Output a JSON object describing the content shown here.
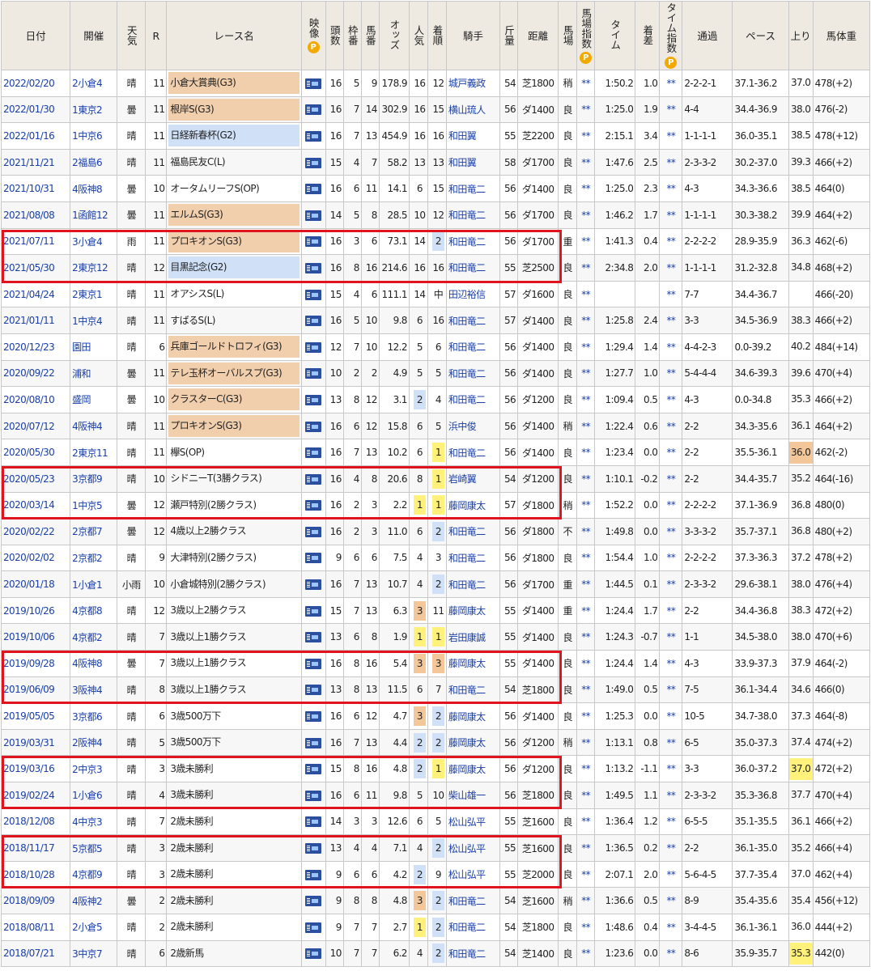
{
  "headers": {
    "date": "日付",
    "venue": "開催",
    "weather": "天気",
    "round": "R",
    "race": "レース名",
    "video": "映像",
    "heads": "頭数",
    "frame": "枠番",
    "horse": "馬番",
    "odds": "オッズ",
    "pop": "人気",
    "rank": "着順",
    "jockey": "騎手",
    "weight": "斤量",
    "dist": "距離",
    "track": "馬場",
    "track_index": "馬場指数",
    "time": "タイム",
    "margin": "着差",
    "time_index": "タイム指数",
    "passing": "通過",
    "pace": "ペース",
    "last3f": "上り",
    "body_weight": "馬体重",
    "p_icon_text": "P"
  },
  "rows": [
    {
      "date": "2022/02/20",
      "venue": "2小倉4",
      "weather": "晴",
      "round": "11",
      "race": "小倉大賞典(G3)",
      "grade": "g3",
      "heads": "16",
      "frame": "5",
      "horse": "9",
      "odds": "178.9",
      "pop": "16",
      "rank": "12",
      "jockey": "城戸義政",
      "weight": "54",
      "dist": "芝1800",
      "track": "稍",
      "ti": "**",
      "time": "1:50.2",
      "margin": "1.0",
      "tix": "**",
      "passing": "2-2-2-1",
      "pace": "37.1-36.2",
      "last3f": "37.0",
      "bw": "478(+2)"
    },
    {
      "date": "2022/01/30",
      "venue": "1東京2",
      "weather": "曇",
      "round": "11",
      "race": "根岸S(G3)",
      "grade": "g3",
      "heads": "16",
      "frame": "7",
      "horse": "14",
      "odds": "302.9",
      "pop": "16",
      "rank": "15",
      "jockey": "横山琉人",
      "weight": "56",
      "dist": "ダ1400",
      "track": "良",
      "ti": "**",
      "time": "1:25.0",
      "margin": "1.9",
      "tix": "**",
      "passing": "4-4",
      "pace": "34.4-36.9",
      "last3f": "38.0",
      "bw": "476(-2)"
    },
    {
      "date": "2022/01/16",
      "venue": "1中京6",
      "weather": "晴",
      "round": "11",
      "race": "日経新春杯(G2)",
      "grade": "g2",
      "heads": "16",
      "frame": "7",
      "horse": "13",
      "odds": "454.9",
      "pop": "16",
      "rank": "16",
      "jockey": "和田翼",
      "weight": "55",
      "dist": "芝2200",
      "track": "良",
      "ti": "**",
      "time": "2:15.1",
      "margin": "3.4",
      "tix": "**",
      "passing": "1-1-1-1",
      "pace": "36.0-35.1",
      "last3f": "38.5",
      "bw": "478(+12)"
    },
    {
      "date": "2021/11/21",
      "venue": "2福島6",
      "weather": "晴",
      "round": "11",
      "race": "福島民友C(L)",
      "grade": "",
      "heads": "15",
      "frame": "4",
      "horse": "7",
      "odds": "58.2",
      "pop": "13",
      "rank": "13",
      "jockey": "和田翼",
      "weight": "58",
      "dist": "ダ1700",
      "track": "良",
      "ti": "**",
      "time": "1:47.6",
      "margin": "2.5",
      "tix": "**",
      "passing": "2-3-3-2",
      "pace": "30.2-37.0",
      "last3f": "39.3",
      "bw": "466(+2)"
    },
    {
      "date": "2021/10/31",
      "venue": "4阪神8",
      "weather": "曇",
      "round": "10",
      "race": "オータムリーフS(OP)",
      "grade": "",
      "heads": "16",
      "frame": "6",
      "horse": "11",
      "odds": "14.1",
      "pop": "6",
      "rank": "15",
      "jockey": "和田竜二",
      "weight": "56",
      "dist": "ダ1400",
      "track": "良",
      "ti": "**",
      "time": "1:25.0",
      "margin": "2.3",
      "tix": "**",
      "passing": "4-3",
      "pace": "34.3-36.6",
      "last3f": "38.5",
      "bw": "464(0)"
    },
    {
      "date": "2021/08/08",
      "venue": "1函館12",
      "weather": "曇",
      "round": "11",
      "race": "エルムS(G3)",
      "grade": "g3",
      "heads": "14",
      "frame": "5",
      "horse": "8",
      "odds": "28.5",
      "pop": "10",
      "rank": "12",
      "jockey": "和田竜二",
      "weight": "56",
      "dist": "ダ1700",
      "track": "良",
      "ti": "**",
      "time": "1:46.2",
      "margin": "1.7",
      "tix": "**",
      "passing": "1-1-1-1",
      "pace": "30.3-38.2",
      "last3f": "39.9",
      "bw": "464(+2)"
    },
    {
      "date": "2021/07/11",
      "venue": "3小倉4",
      "weather": "雨",
      "round": "11",
      "race": "プロキオンS(G3)",
      "grade": "g3",
      "heads": "16",
      "frame": "3",
      "horse": "6",
      "odds": "73.1",
      "pop": "14",
      "rank": "2",
      "rankhl": "b",
      "jockey": "和田竜二",
      "weight": "56",
      "dist": "ダ1700",
      "track": "重",
      "ti": "**",
      "time": "1:41.3",
      "margin": "0.4",
      "tix": "**",
      "passing": "2-2-2-2",
      "pace": "28.9-35.9",
      "last3f": "36.3",
      "bw": "462(-6)"
    },
    {
      "date": "2021/05/30",
      "venue": "2東京12",
      "weather": "晴",
      "round": "12",
      "race": "目黒記念(G2)",
      "grade": "g2",
      "heads": "16",
      "frame": "8",
      "horse": "16",
      "odds": "214.6",
      "pop": "16",
      "rank": "16",
      "jockey": "和田竜二",
      "weight": "55",
      "dist": "芝2500",
      "track": "良",
      "ti": "**",
      "time": "2:34.8",
      "margin": "2.0",
      "tix": "**",
      "passing": "1-1-1-1",
      "pace": "31.2-32.8",
      "last3f": "34.8",
      "bw": "468(+2)"
    },
    {
      "date": "2021/04/24",
      "venue": "2東京1",
      "weather": "晴",
      "round": "11",
      "race": "オアシスS(L)",
      "grade": "",
      "heads": "15",
      "frame": "4",
      "horse": "6",
      "odds": "111.1",
      "pop": "14",
      "rank": "中",
      "jockey": "田辺裕信",
      "weight": "57",
      "dist": "ダ1600",
      "track": "良",
      "ti": "**",
      "time": "",
      "margin": "",
      "tix": "**",
      "passing": "7-7",
      "pace": "34.4-36.7",
      "last3f": "",
      "bw": "466(-20)"
    },
    {
      "date": "2021/01/11",
      "venue": "1中京4",
      "weather": "晴",
      "round": "11",
      "race": "すばるS(L)",
      "grade": "",
      "heads": "16",
      "frame": "5",
      "horse": "10",
      "odds": "9.8",
      "pop": "6",
      "rank": "16",
      "jockey": "和田竜二",
      "weight": "57",
      "dist": "ダ1400",
      "track": "良",
      "ti": "**",
      "time": "1:25.8",
      "margin": "2.4",
      "tix": "**",
      "passing": "3-3",
      "pace": "34.5-36.9",
      "last3f": "38.3",
      "bw": "466(+2)"
    },
    {
      "date": "2020/12/23",
      "venue": "園田",
      "weather": "晴",
      "round": "6",
      "race": "兵庫ゴールドトロフィ(G3)",
      "grade": "g3",
      "heads": "12",
      "frame": "7",
      "horse": "10",
      "odds": "12.2",
      "pop": "5",
      "rank": "6",
      "jockey": "和田竜二",
      "weight": "56",
      "dist": "ダ1400",
      "track": "良",
      "ti": "**",
      "time": "1:29.4",
      "margin": "1.4",
      "tix": "**",
      "passing": "4-4-2-3",
      "pace": "0.0-39.2",
      "last3f": "40.2",
      "bw": "484(+14)"
    },
    {
      "date": "2020/09/22",
      "venue": "浦和",
      "weather": "曇",
      "round": "11",
      "race": "テレ玉杯オーバルスプ(G3)",
      "grade": "g3",
      "heads": "10",
      "frame": "2",
      "horse": "2",
      "odds": "4.9",
      "pop": "5",
      "rank": "5",
      "jockey": "和田竜二",
      "weight": "56",
      "dist": "ダ1400",
      "track": "良",
      "ti": "**",
      "time": "1:27.7",
      "margin": "1.0",
      "tix": "**",
      "passing": "5-4-4-4",
      "pace": "34.6-39.3",
      "last3f": "39.6",
      "bw": "470(+4)"
    },
    {
      "date": "2020/08/10",
      "venue": "盛岡",
      "weather": "曇",
      "round": "10",
      "race": "クラスターC(G3)",
      "grade": "g3",
      "heads": "13",
      "frame": "8",
      "horse": "12",
      "odds": "3.1",
      "pop": "2",
      "pophl": "b",
      "rank": "4",
      "jockey": "和田竜二",
      "weight": "56",
      "dist": "ダ1200",
      "track": "良",
      "ti": "**",
      "time": "1:09.4",
      "margin": "0.5",
      "tix": "**",
      "passing": "4-3",
      "pace": "0.0-34.8",
      "last3f": "35.3",
      "bw": "466(+2)"
    },
    {
      "date": "2020/07/12",
      "venue": "4阪神4",
      "weather": "晴",
      "round": "11",
      "race": "プロキオンS(G3)",
      "grade": "g3",
      "heads": "16",
      "frame": "6",
      "horse": "12",
      "odds": "15.8",
      "pop": "6",
      "rank": "5",
      "jockey": "浜中俊",
      "weight": "56",
      "dist": "ダ1400",
      "track": "稍",
      "ti": "**",
      "time": "1:22.4",
      "margin": "0.6",
      "tix": "**",
      "passing": "2-2",
      "pace": "34.3-35.6",
      "last3f": "36.1",
      "bw": "464(+2)"
    },
    {
      "date": "2020/05/30",
      "venue": "2東京11",
      "weather": "晴",
      "round": "11",
      "race": "欅S(OP)",
      "grade": "",
      "heads": "16",
      "frame": "7",
      "horse": "13",
      "odds": "10.2",
      "pop": "6",
      "rank": "1",
      "rankhl": "y",
      "jockey": "和田竜二",
      "weight": "56",
      "dist": "ダ1400",
      "track": "良",
      "ti": "**",
      "time": "1:23.4",
      "margin": "0.0",
      "tix": "**",
      "passing": "2-2",
      "pace": "35.5-36.1",
      "last3f": "36.0",
      "uphl": "o",
      "bw": "462(-2)"
    },
    {
      "date": "2020/05/23",
      "venue": "3京都9",
      "weather": "晴",
      "round": "10",
      "race": "シドニーT(3勝クラス)",
      "grade": "",
      "heads": "16",
      "frame": "4",
      "horse": "8",
      "odds": "20.6",
      "pop": "8",
      "rank": "1",
      "rankhl": "y",
      "jockey": "岩崎翼",
      "weight": "54",
      "dist": "ダ1200",
      "track": "良",
      "ti": "**",
      "time": "1:10.1",
      "margin": "-0.2",
      "tix": "**",
      "passing": "2-2",
      "pace": "34.4-35.7",
      "last3f": "35.2",
      "bw": "464(-16)"
    },
    {
      "date": "2020/03/14",
      "venue": "1中京5",
      "weather": "曇",
      "round": "12",
      "race": "瀬戸特別(2勝クラス)",
      "grade": "",
      "heads": "16",
      "frame": "2",
      "horse": "3",
      "odds": "2.2",
      "pop": "1",
      "pophl": "y",
      "rank": "1",
      "rankhl": "y",
      "jockey": "藤岡康太",
      "weight": "57",
      "dist": "ダ1800",
      "track": "稍",
      "ti": "**",
      "time": "1:52.2",
      "margin": "0.0",
      "tix": "**",
      "passing": "2-2-2-2",
      "pace": "37.1-36.9",
      "last3f": "36.8",
      "bw": "480(0)"
    },
    {
      "date": "2020/02/22",
      "venue": "2京都7",
      "weather": "曇",
      "round": "12",
      "race": "4歳以上2勝クラス",
      "grade": "",
      "heads": "16",
      "frame": "2",
      "horse": "3",
      "odds": "11.0",
      "pop": "6",
      "rank": "2",
      "rankhl": "b",
      "jockey": "和田竜二",
      "weight": "56",
      "dist": "ダ1800",
      "track": "不",
      "ti": "**",
      "time": "1:49.8",
      "margin": "0.0",
      "tix": "**",
      "passing": "3-3-3-2",
      "pace": "35.7-37.1",
      "last3f": "36.8",
      "bw": "480(+2)"
    },
    {
      "date": "2020/02/02",
      "venue": "2京都2",
      "weather": "晴",
      "round": "9",
      "race": "大津特別(2勝クラス)",
      "grade": "",
      "heads": "9",
      "frame": "6",
      "horse": "6",
      "odds": "7.5",
      "pop": "4",
      "rank": "3",
      "jockey": "和田竜二",
      "weight": "56",
      "dist": "ダ1800",
      "track": "良",
      "ti": "**",
      "time": "1:54.4",
      "margin": "1.0",
      "tix": "**",
      "passing": "2-2-2-2",
      "pace": "37.3-36.3",
      "last3f": "37.2",
      "bw": "478(+2)"
    },
    {
      "date": "2020/01/18",
      "venue": "1小倉1",
      "weather": "小雨",
      "round": "10",
      "race": "小倉城特別(2勝クラス)",
      "grade": "",
      "heads": "16",
      "frame": "7",
      "horse": "13",
      "odds": "10.7",
      "pop": "4",
      "rank": "2",
      "rankhl": "b",
      "jockey": "和田竜二",
      "weight": "56",
      "dist": "ダ1700",
      "track": "重",
      "ti": "**",
      "time": "1:44.5",
      "margin": "0.1",
      "tix": "**",
      "passing": "2-3-3-2",
      "pace": "29.6-38.1",
      "last3f": "38.0",
      "bw": "476(+4)"
    },
    {
      "date": "2019/10/26",
      "venue": "4京都8",
      "weather": "晴",
      "round": "12",
      "race": "3歳以上2勝クラス",
      "grade": "",
      "heads": "15",
      "frame": "7",
      "horse": "13",
      "odds": "6.3",
      "pop": "3",
      "pophl": "o",
      "rank": "11",
      "jockey": "藤岡康太",
      "weight": "55",
      "dist": "ダ1400",
      "track": "重",
      "ti": "**",
      "time": "1:24.4",
      "margin": "1.7",
      "tix": "**",
      "passing": "2-2",
      "pace": "34.4-36.8",
      "last3f": "38.3",
      "bw": "472(+2)"
    },
    {
      "date": "2019/10/06",
      "venue": "4京都2",
      "weather": "晴",
      "round": "7",
      "race": "3歳以上1勝クラス",
      "grade": "",
      "heads": "13",
      "frame": "6",
      "horse": "8",
      "odds": "1.9",
      "pop": "1",
      "pophl": "y",
      "rank": "1",
      "rankhl": "y",
      "jockey": "岩田康誠",
      "weight": "55",
      "dist": "ダ1400",
      "track": "良",
      "ti": "**",
      "time": "1:24.3",
      "margin": "-0.7",
      "tix": "**",
      "passing": "1-1",
      "pace": "34.5-38.0",
      "last3f": "38.0",
      "bw": "470(+6)"
    },
    {
      "date": "2019/09/28",
      "venue": "4阪神8",
      "weather": "曇",
      "round": "7",
      "race": "3歳以上1勝クラス",
      "grade": "",
      "heads": "16",
      "frame": "8",
      "horse": "16",
      "odds": "5.4",
      "pop": "3",
      "pophl": "o",
      "rank": "3",
      "rankhl": "o",
      "jockey": "藤岡康太",
      "weight": "55",
      "dist": "ダ1400",
      "track": "良",
      "ti": "**",
      "time": "1:24.4",
      "margin": "1.4",
      "tix": "**",
      "passing": "4-3",
      "pace": "33.9-37.3",
      "last3f": "37.9",
      "bw": "464(-2)"
    },
    {
      "date": "2019/06/09",
      "venue": "3阪神4",
      "weather": "晴",
      "round": "8",
      "race": "3歳以上1勝クラス",
      "grade": "",
      "heads": "13",
      "frame": "8",
      "horse": "13",
      "odds": "11.5",
      "pop": "6",
      "rank": "7",
      "jockey": "和田竜二",
      "weight": "54",
      "dist": "芝1800",
      "track": "良",
      "ti": "**",
      "time": "1:49.0",
      "margin": "0.5",
      "tix": "**",
      "passing": "7-5",
      "pace": "36.1-34.4",
      "last3f": "34.6",
      "bw": "466(0)"
    },
    {
      "date": "2019/05/05",
      "venue": "3京都6",
      "weather": "晴",
      "round": "6",
      "race": "3歳500万下",
      "grade": "",
      "heads": "16",
      "frame": "6",
      "horse": "12",
      "odds": "4.7",
      "pop": "3",
      "pophl": "o",
      "rank": "2",
      "rankhl": "b",
      "jockey": "藤岡康太",
      "weight": "56",
      "dist": "ダ1400",
      "track": "良",
      "ti": "**",
      "time": "1:25.3",
      "margin": "0.0",
      "tix": "**",
      "passing": "10-5",
      "pace": "34.7-38.0",
      "last3f": "37.3",
      "uphl": "b",
      "bw": "464(-8)"
    },
    {
      "date": "2019/03/31",
      "venue": "2阪神4",
      "weather": "晴",
      "round": "5",
      "race": "3歳500万下",
      "grade": "",
      "heads": "16",
      "frame": "7",
      "horse": "13",
      "odds": "4.4",
      "pop": "2",
      "pophl": "b",
      "rank": "2",
      "rankhl": "b",
      "jockey": "藤岡康太",
      "weight": "56",
      "dist": "ダ1200",
      "track": "稍",
      "ti": "**",
      "time": "1:13.1",
      "margin": "0.8",
      "tix": "**",
      "passing": "6-5",
      "pace": "35.0-37.3",
      "last3f": "37.4",
      "bw": "474(+2)"
    },
    {
      "date": "2019/03/16",
      "venue": "2中京3",
      "weather": "晴",
      "round": "3",
      "race": "3歳未勝利",
      "grade": "",
      "heads": "15",
      "frame": "8",
      "horse": "16",
      "odds": "4.8",
      "pop": "2",
      "pophl": "b",
      "rank": "1",
      "rankhl": "y",
      "jockey": "藤岡康太",
      "weight": "56",
      "dist": "ダ1200",
      "track": "良",
      "ti": "**",
      "time": "1:13.2",
      "margin": "-1.1",
      "tix": "**",
      "passing": "3-3",
      "pace": "36.0-37.2",
      "last3f": "37.0",
      "uphl": "y",
      "bw": "472(+2)"
    },
    {
      "date": "2019/02/24",
      "venue": "1小倉6",
      "weather": "晴",
      "round": "4",
      "race": "3歳未勝利",
      "grade": "",
      "heads": "16",
      "frame": "6",
      "horse": "11",
      "odds": "9.8",
      "pop": "5",
      "rank": "10",
      "jockey": "柴山雄一",
      "weight": "56",
      "dist": "芝1800",
      "track": "良",
      "ti": "**",
      "time": "1:49.5",
      "margin": "1.1",
      "tix": "**",
      "passing": "2-3-3-2",
      "pace": "35.3-36.8",
      "last3f": "37.7",
      "bw": "470(+4)"
    },
    {
      "date": "2018/12/08",
      "venue": "4中京3",
      "weather": "晴",
      "round": "7",
      "race": "2歳未勝利",
      "grade": "",
      "heads": "14",
      "frame": "3",
      "horse": "3",
      "odds": "12.6",
      "pop": "6",
      "rank": "5",
      "jockey": "松山弘平",
      "weight": "55",
      "dist": "芝1600",
      "track": "良",
      "ti": "**",
      "time": "1:36.4",
      "margin": "1.2",
      "tix": "**",
      "passing": "6-5-5",
      "pace": "35.1-35.5",
      "last3f": "36.1",
      "bw": "466(+2)"
    },
    {
      "date": "2018/11/17",
      "venue": "5京都5",
      "weather": "晴",
      "round": "3",
      "race": "2歳未勝利",
      "grade": "",
      "heads": "13",
      "frame": "4",
      "horse": "4",
      "odds": "7.1",
      "pop": "4",
      "rank": "2",
      "rankhl": "b",
      "jockey": "松山弘平",
      "weight": "55",
      "dist": "芝1600",
      "track": "良",
      "ti": "**",
      "time": "1:36.5",
      "margin": "0.2",
      "tix": "**",
      "passing": "2-2",
      "pace": "36.1-35.0",
      "last3f": "35.2",
      "bw": "466(+4)"
    },
    {
      "date": "2018/10/28",
      "venue": "4京都9",
      "weather": "晴",
      "round": "3",
      "race": "2歳未勝利",
      "grade": "",
      "heads": "9",
      "frame": "6",
      "horse": "6",
      "odds": "4.2",
      "pop": "2",
      "pophl": "b",
      "rank": "9",
      "jockey": "松山弘平",
      "weight": "55",
      "dist": "芝2000",
      "track": "良",
      "ti": "**",
      "time": "2:07.1",
      "margin": "2.0",
      "tix": "**",
      "passing": "5-6-4-5",
      "pace": "37.7-35.4",
      "last3f": "37.0",
      "bw": "462(+4)"
    },
    {
      "date": "2018/09/09",
      "venue": "4阪神2",
      "weather": "曇",
      "round": "2",
      "race": "2歳未勝利",
      "grade": "",
      "heads": "9",
      "frame": "8",
      "horse": "8",
      "odds": "4.8",
      "pop": "3",
      "pophl": "o",
      "rank": "2",
      "rankhl": "b",
      "jockey": "和田竜二",
      "weight": "54",
      "dist": "芝1600",
      "track": "稍",
      "ti": "**",
      "time": "1:36.6",
      "margin": "0.5",
      "tix": "**",
      "passing": "8-9",
      "pace": "35.4-35.6",
      "last3f": "35.4",
      "uphl": "b",
      "bw": "456(+12)"
    },
    {
      "date": "2018/08/11",
      "venue": "2小倉5",
      "weather": "晴",
      "round": "2",
      "race": "2歳未勝利",
      "grade": "",
      "heads": "9",
      "frame": "7",
      "horse": "7",
      "odds": "2.7",
      "pop": "1",
      "pophl": "y",
      "rank": "2",
      "rankhl": "b",
      "jockey": "和田竜二",
      "weight": "54",
      "dist": "芝1800",
      "track": "良",
      "ti": "**",
      "time": "1:48.6",
      "margin": "0.4",
      "tix": "**",
      "passing": "3-4-4-5",
      "pace": "36.1-36.1",
      "last3f": "36.0",
      "uphl": "b",
      "bw": "444(+2)"
    },
    {
      "date": "2018/07/21",
      "venue": "3中京7",
      "weather": "晴",
      "round": "6",
      "race": "2歳新馬",
      "grade": "",
      "heads": "10",
      "frame": "7",
      "horse": "7",
      "odds": "6.2",
      "pop": "4",
      "rank": "2",
      "rankhl": "b",
      "jockey": "和田竜二",
      "weight": "54",
      "dist": "芝1400",
      "track": "良",
      "ti": "**",
      "time": "1:23.6",
      "margin": "0.0",
      "tix": "**",
      "passing": "8-6",
      "pace": "35.9-35.7",
      "last3f": "35.3",
      "uphl": "y",
      "bw": "442(0)"
    }
  ]
}
